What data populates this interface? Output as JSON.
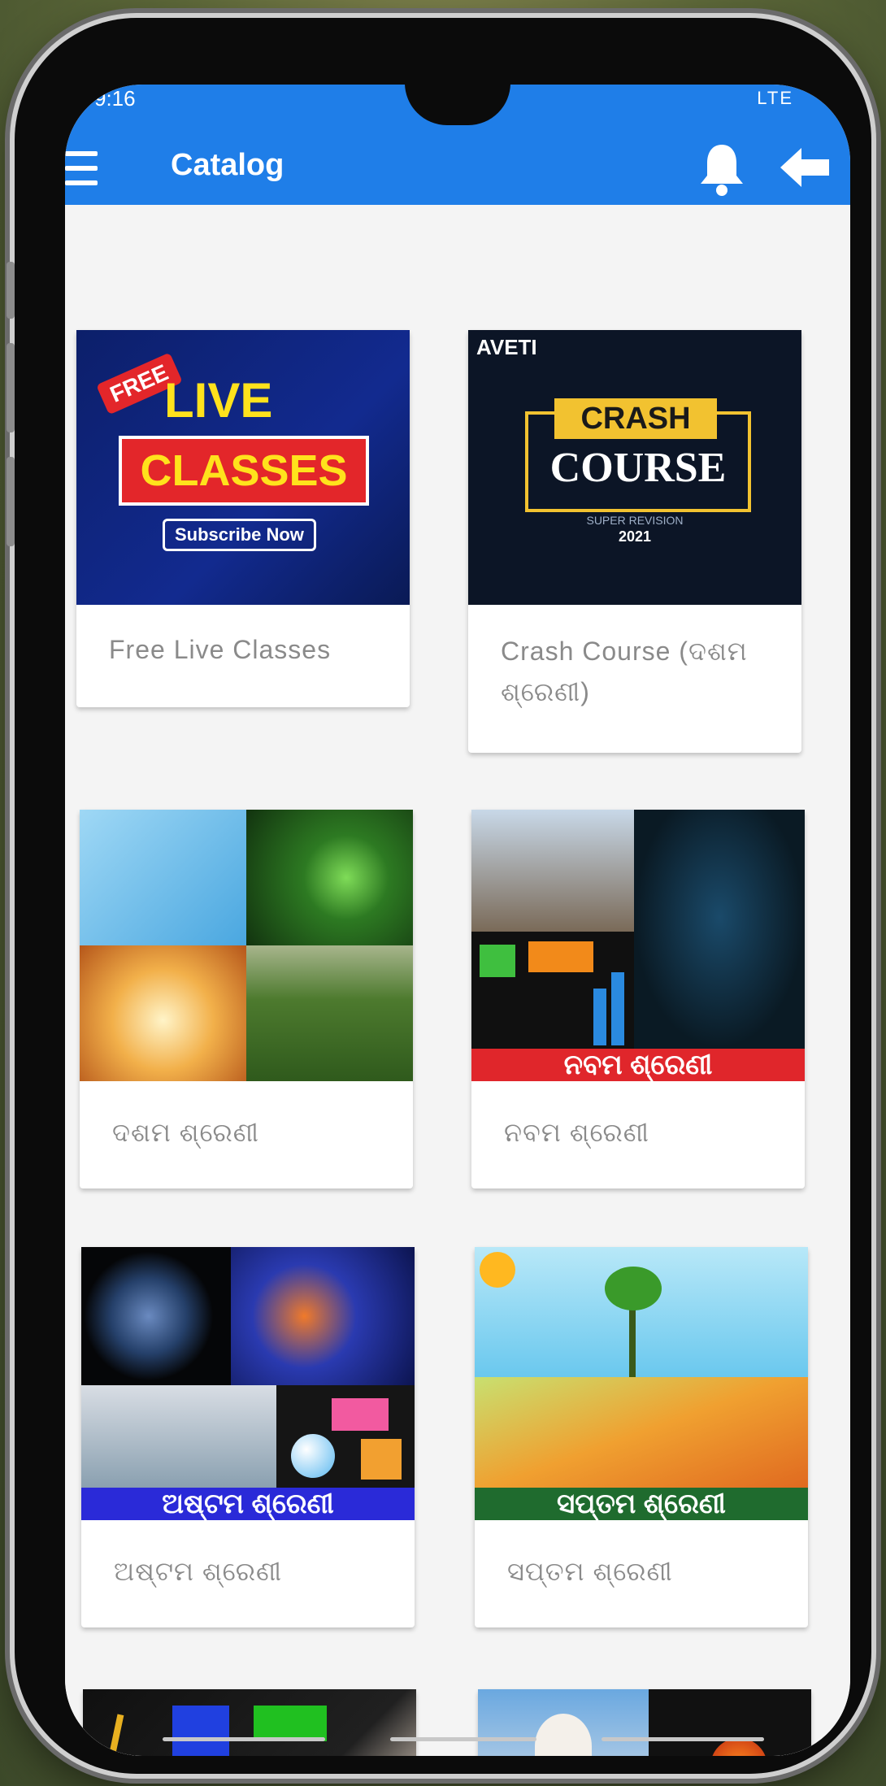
{
  "status_bar": {
    "time": "9:16",
    "signal": "LTE"
  },
  "app_bar": {
    "title": "Catalog",
    "menu_icon": "hamburger-menu-icon",
    "notification_icon": "bell-icon",
    "back_icon": "arrow-left-icon"
  },
  "colors": {
    "primary": "#1f7ee8",
    "card_label": "#8a8a8a",
    "banner_red": "#e0262b",
    "banner_blue": "#2a2ad8",
    "banner_green": "#1f6b2e"
  },
  "catalog": {
    "items": [
      {
        "label": "Free Live Classes",
        "thumb": {
          "badge": "FREE",
          "line1": "LIVE",
          "line2": "CLASSES",
          "cta": "Subscribe Now"
        }
      },
      {
        "label": "Crash Course (ଦଶମ ଶ୍ରେଣୀ)",
        "thumb": {
          "brand": "AVETI",
          "line1": "CRASH",
          "line2": "COURSE",
          "sub": "SUPER REVISION",
          "year": "2021"
        }
      },
      {
        "label": "ଦଶମ ଶ୍ରେଣୀ"
      },
      {
        "label": "ନବମ ଶ୍ରେଣୀ",
        "thumb": {
          "banner": "ନବମ ଶ୍ରେଣୀ"
        }
      },
      {
        "label": "ଅଷ୍ଟମ ଶ୍ରେଣୀ",
        "thumb": {
          "banner": "ଅଷ୍ଟମ ଶ୍ରେଣୀ"
        }
      },
      {
        "label": "ସପ୍ତମ ଶ୍ରେଣୀ",
        "thumb": {
          "banner": "ସପ୍ତମ ଶ୍ରେଣୀ"
        }
      }
    ]
  }
}
